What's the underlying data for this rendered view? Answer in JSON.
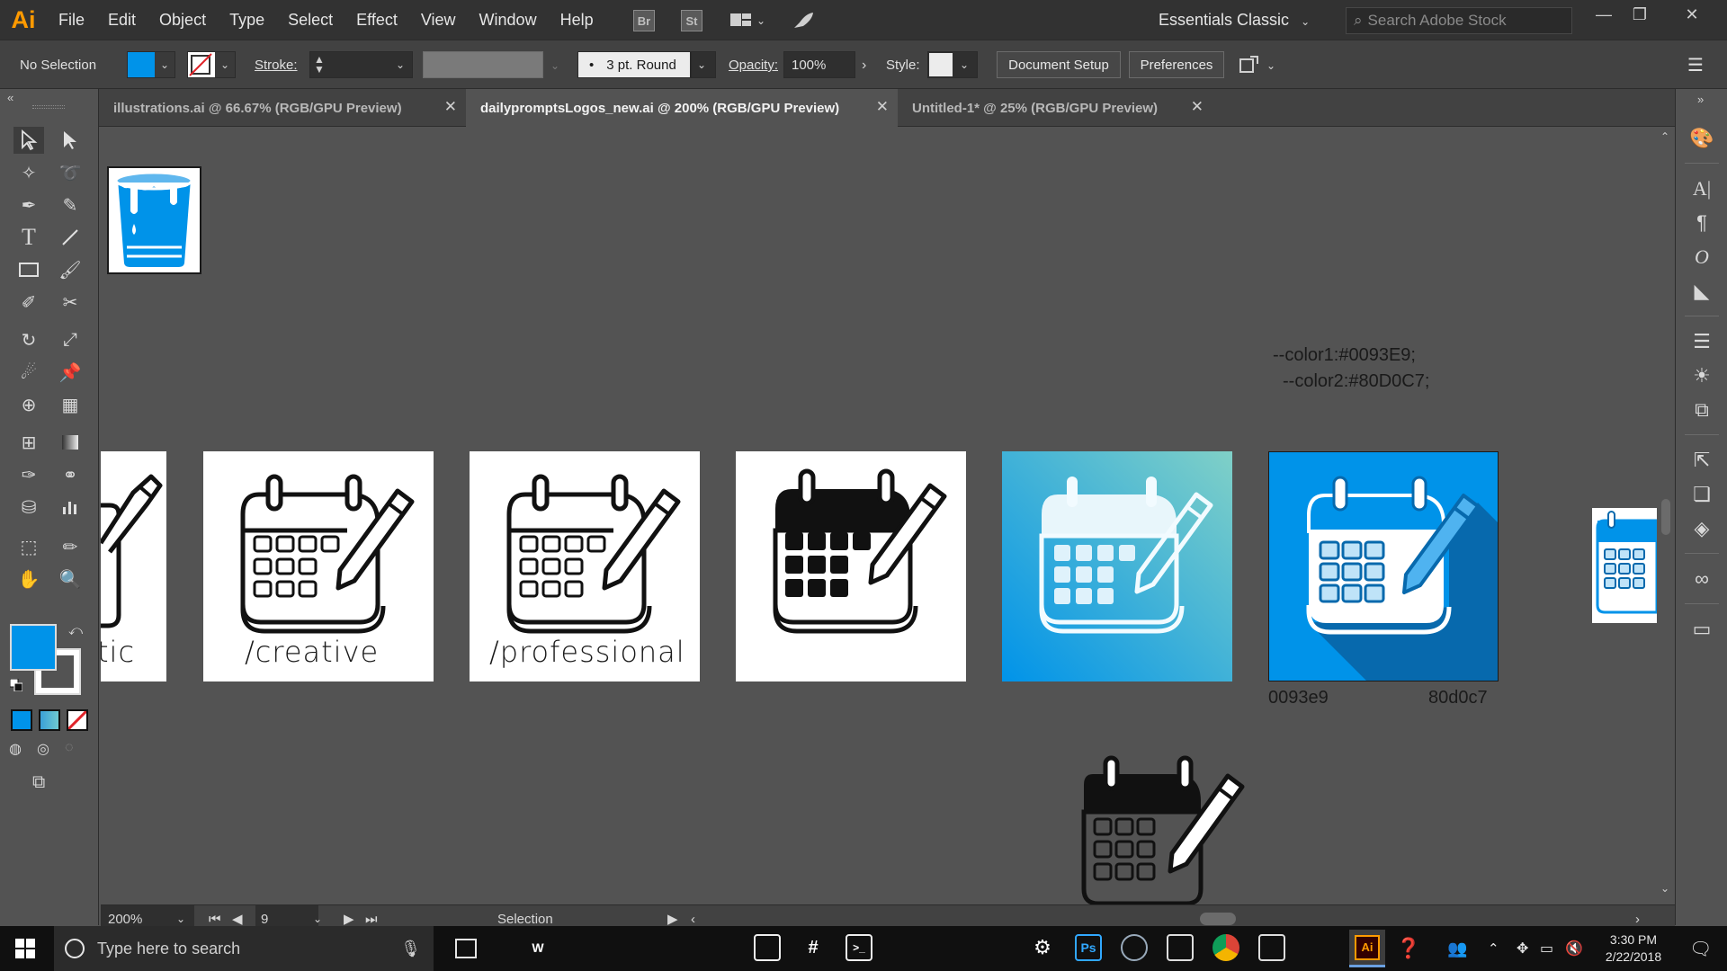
{
  "app": {
    "logo_text": "Ai"
  },
  "menu": [
    "File",
    "Edit",
    "Object",
    "Type",
    "Select",
    "Effect",
    "View",
    "Window",
    "Help"
  ],
  "menubar": {
    "bridge_badge": "Br",
    "stock_badge": "St",
    "workspace": "Essentials Classic",
    "search_placeholder": "Search Adobe Stock"
  },
  "control": {
    "selection": "No Selection",
    "fill_color": "#0093e9",
    "stroke_label": "Stroke:",
    "brush": "3 pt. Round",
    "brush_dot": "•",
    "opacity_label": "Opacity:",
    "opacity": "100%",
    "style_label": "Style:",
    "document_setup": "Document Setup",
    "preferences": "Preferences"
  },
  "tabs": [
    {
      "label": "illustrations.ai @ 66.67% (RGB/GPU Preview)",
      "active": false
    },
    {
      "label": "dailypromptsLogos_new.ai @ 200% (RGB/GPU Preview)",
      "active": true
    },
    {
      "label": "Untitled-1* @ 25% (RGB/GPU Preview)",
      "active": false
    }
  ],
  "canvas": {
    "artboards": [
      {
        "label": "tic",
        "style": "outline"
      },
      {
        "label": "/creative",
        "style": "outline"
      },
      {
        "label": "/professional",
        "style": "outline"
      },
      {
        "label": "",
        "style": "solid-black"
      },
      {
        "label": "",
        "style": "gradient-blue"
      },
      {
        "label": "",
        "style": "blue-shadow"
      }
    ],
    "css_note_1": "--color1:#0093E9;",
    "css_note_2": "--color2:#80D0C7;",
    "color_caption_1": "0093e9",
    "color_caption_2": "80d0c7",
    "colors": {
      "color1": "#0093E9",
      "color2": "#80D0C7"
    }
  },
  "status": {
    "zoom": "200%",
    "artboard_number": "9",
    "tool": "Selection"
  },
  "taskbar": {
    "search_placeholder": "Type here to search",
    "time": "3:30 PM",
    "date": "2/22/2018",
    "apps": [
      {
        "name": "word",
        "label": "W",
        "color": "#2b579a"
      },
      {
        "name": "firefox",
        "label": "",
        "color": "#ff7139"
      },
      {
        "name": "atom",
        "label": "",
        "color": "#3fa36f"
      },
      {
        "name": "explorer",
        "label": "",
        "color": "#f5c342"
      },
      {
        "name": "eclipse",
        "label": "",
        "color": "#3b3b8c"
      },
      {
        "name": "photos",
        "label": "",
        "color": "#222"
      },
      {
        "name": "slack",
        "label": "#",
        "color": "#222"
      },
      {
        "name": "terminal",
        "label": ">_",
        "color": "#222"
      },
      {
        "name": "acrobat",
        "label": "",
        "color": "#c0392b"
      },
      {
        "name": "spotify",
        "label": "",
        "color": "#1db954"
      },
      {
        "name": "visual-studio",
        "label": "",
        "color": "#68217a"
      },
      {
        "name": "settings",
        "label": "⚙",
        "color": "#222"
      },
      {
        "name": "photoshop",
        "label": "Ps",
        "color": "#001d34"
      },
      {
        "name": "steam",
        "label": "",
        "color": "#1b2838"
      },
      {
        "name": "inkscape",
        "label": "",
        "color": "#222"
      },
      {
        "name": "chrome",
        "label": "",
        "color": "#db4437"
      },
      {
        "name": "paint",
        "label": "",
        "color": "#444"
      },
      {
        "name": "notepad",
        "label": "",
        "color": "#7fb5d6"
      },
      {
        "name": "illustrator",
        "label": "Ai",
        "color": "#330000"
      }
    ]
  }
}
